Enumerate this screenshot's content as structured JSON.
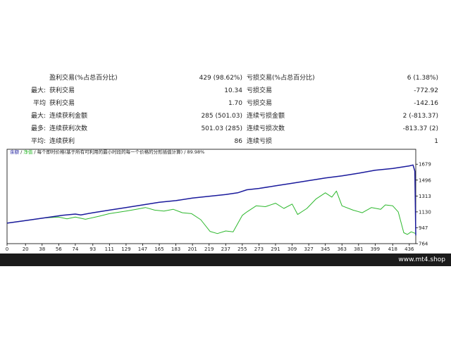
{
  "stats": {
    "rows": [
      {
        "prefix": "",
        "label1": "盈利交易(%占总百分比)",
        "value1": "429 (98.62%)",
        "label2": "亏损交易(%占总百分比)",
        "value2": "6 (1.38%)"
      },
      {
        "prefix": "最大:",
        "label1": "获利交易",
        "value1": "10.34",
        "label2": "亏损交易",
        "value2": "-772.92"
      },
      {
        "prefix": "平均",
        "label1": "获利交易",
        "value1": "1.70",
        "label2": "亏损交易",
        "value2": "-142.16"
      },
      {
        "prefix": "最大:",
        "label1": "连续获利金额",
        "value1": "285 (501.03)",
        "label2": "连续亏损金额",
        "value2": "2 (-813.37)"
      },
      {
        "prefix": "最多:",
        "label1": "连续获利次数",
        "value1": "501.03 (285)",
        "label2": "连续亏损次数",
        "value2": "-813.37 (2)"
      },
      {
        "prefix": "平均:",
        "label1": "连续获利",
        "value1": "86",
        "label2": "连续亏损",
        "value2": "1"
      }
    ]
  },
  "chart_legend": {
    "balance": "余额",
    "sep1": " / ",
    "equity": "净值",
    "rest": " / 每个即时价格(基于所有可利用的最小时段的每一个价格的分形插值计算) / 89.98%"
  },
  "footer": {
    "site": "www.mt4.shop"
  },
  "colors": {
    "balance": "#1a1a9c",
    "equity": "#2db82d",
    "axis": "#000000"
  },
  "chart_data": {
    "type": "line",
    "x_ticks": [
      "0",
      "20",
      "38",
      "56",
      "74",
      "93",
      "111",
      "129",
      "147",
      "165",
      "183",
      "201",
      "219",
      "237",
      "255",
      "273",
      "291",
      "309",
      "327",
      "345",
      "363",
      "381",
      "399",
      "418",
      "436"
    ],
    "y_ticks": [
      "1679",
      "1496",
      "1313",
      "1130",
      "947",
      "764"
    ],
    "ylim": [
      764,
      1770
    ],
    "xlim": [
      0,
      443
    ],
    "series": [
      {
        "name": "余额",
        "points": [
          [
            0,
            1000
          ],
          [
            20,
            1030
          ],
          [
            40,
            1060
          ],
          [
            60,
            1090
          ],
          [
            74,
            1105
          ],
          [
            80,
            1095
          ],
          [
            93,
            1120
          ],
          [
            111,
            1150
          ],
          [
            129,
            1180
          ],
          [
            147,
            1210
          ],
          [
            165,
            1240
          ],
          [
            183,
            1260
          ],
          [
            201,
            1290
          ],
          [
            219,
            1310
          ],
          [
            237,
            1330
          ],
          [
            250,
            1350
          ],
          [
            260,
            1385
          ],
          [
            273,
            1400
          ],
          [
            291,
            1430
          ],
          [
            309,
            1460
          ],
          [
            327,
            1490
          ],
          [
            345,
            1520
          ],
          [
            363,
            1545
          ],
          [
            381,
            1575
          ],
          [
            399,
            1610
          ],
          [
            418,
            1630
          ],
          [
            436,
            1660
          ],
          [
            440,
            1670
          ],
          [
            442,
            1600
          ],
          [
            443,
            860
          ]
        ]
      },
      {
        "name": "净值",
        "points": [
          [
            0,
            1000
          ],
          [
            20,
            1030
          ],
          [
            40,
            1060
          ],
          [
            56,
            1070
          ],
          [
            65,
            1050
          ],
          [
            74,
            1070
          ],
          [
            85,
            1045
          ],
          [
            100,
            1080
          ],
          [
            111,
            1110
          ],
          [
            129,
            1140
          ],
          [
            140,
            1160
          ],
          [
            150,
            1180
          ],
          [
            160,
            1150
          ],
          [
            170,
            1140
          ],
          [
            180,
            1160
          ],
          [
            190,
            1120
          ],
          [
            200,
            1110
          ],
          [
            210,
            1040
          ],
          [
            220,
            905
          ],
          [
            228,
            880
          ],
          [
            237,
            910
          ],
          [
            245,
            900
          ],
          [
            255,
            1090
          ],
          [
            260,
            1130
          ],
          [
            270,
            1200
          ],
          [
            280,
            1190
          ],
          [
            291,
            1230
          ],
          [
            300,
            1170
          ],
          [
            309,
            1220
          ],
          [
            315,
            1100
          ],
          [
            325,
            1170
          ],
          [
            335,
            1280
          ],
          [
            345,
            1350
          ],
          [
            352,
            1300
          ],
          [
            357,
            1370
          ],
          [
            363,
            1200
          ],
          [
            375,
            1150
          ],
          [
            385,
            1120
          ],
          [
            395,
            1180
          ],
          [
            405,
            1160
          ],
          [
            410,
            1210
          ],
          [
            418,
            1200
          ],
          [
            424,
            1130
          ],
          [
            430,
            890
          ],
          [
            434,
            870
          ],
          [
            438,
            900
          ],
          [
            443,
            880
          ]
        ]
      }
    ]
  }
}
